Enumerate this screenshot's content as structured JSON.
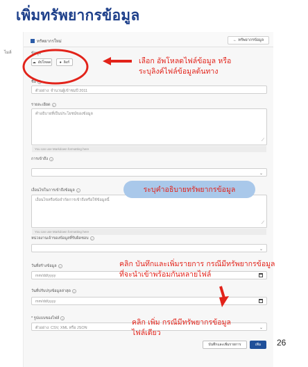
{
  "slide": {
    "title": "เพิ่มทรัพยากรข้อมูล",
    "page_number": "26",
    "side_fragment": "ไมล์"
  },
  "form": {
    "header": {
      "title": "ทรัพยากรใหม่",
      "back_label": "ทรัพยากรข้อมูล"
    },
    "data_label": "ข้อมูล",
    "upload_label": "อัปโหลด",
    "link_label": "ลิงก์",
    "name": {
      "label": "ชื่อ",
      "value": "ตัวอย่าง: จำนวนผู้เข้าชมปี 2011"
    },
    "description": {
      "label": "รายละเอียด",
      "placeholder": "คำอธิบายที่เป็นประโยชน์ของข้อมูล",
      "hint": "You can use Markdown formatting here"
    },
    "format": {
      "label": "การเข้าถึง"
    },
    "condition": {
      "label": "เงื่อนไขในการเข้าถึงข้อมูล",
      "placeholder": "เงื่อนไขหรือข้อจำกัดการเข้าถึงหรือใช้ข้อมูลนี้",
      "hint": "You can use Markdown formatting here"
    },
    "unit": {
      "label": "หน่วยงานเจ้าของข้อมูลที่รับผิดชอบ"
    },
    "created_date": {
      "label": "วันที่สร้างข้อมูล",
      "placeholder": "mm/dd/yyyy"
    },
    "updated_date": {
      "label": "วันที่ปรับปรุงข้อมูลล่าสุด",
      "placeholder": "mm/dd/yyyy"
    },
    "file_format": {
      "label": "* รูปแบบของไฟล์",
      "placeholder": "ตัวอย่าง: CSV, XML หรือ JSON"
    },
    "save_add_label": "บันทึกและเพิ่มรายการ",
    "add_label": "เพิ่ม"
  },
  "annotations": {
    "upload_note_line1": "เลือก อัพโหลดไฟล์ข้อมูล หรือ",
    "upload_note_line2": "ระบุลิงค์ไฟล์ข้อมูลต้นทาง",
    "describe_note": "ระบุคำอธิบายทรัพยากรข้อมูล",
    "save_note_line1": "คลิก บันทึกและเพิ่มรายการ กรณีมีทรัพยากรข้อมูล",
    "save_note_line2": "ที่จะนำเข้าพร้อมกันหลายไฟล์",
    "add_note_line1": "คลิก เพิ่ม กรณีมีทรัพยากรข้อมูล",
    "add_note_line2": "ไฟล์เดียว"
  },
  "colors": {
    "title": "#1d3f8a",
    "annotation": "#e2231a",
    "pill": "#a9c8ea",
    "primary": "#1f4f99"
  }
}
